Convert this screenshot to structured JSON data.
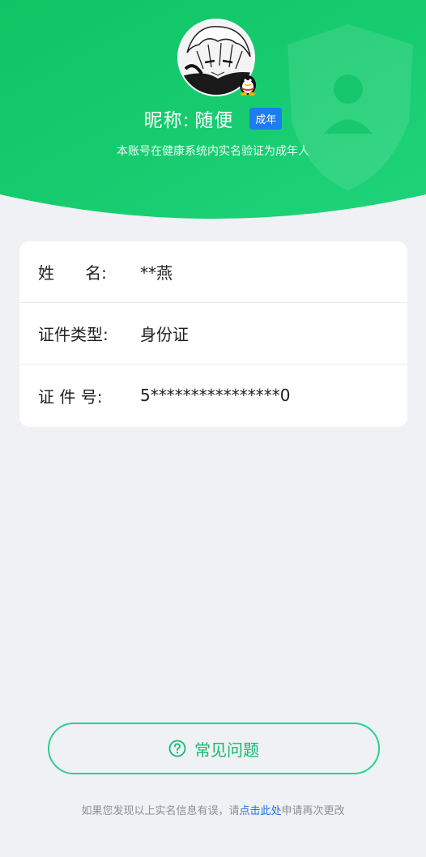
{
  "profile": {
    "nickname_label": "昵称:",
    "nickname": "随便",
    "age_badge": "成年",
    "verify_note": "本账号在健康系统内实名验证为成年人"
  },
  "info_rows": [
    {
      "label": "姓      名:",
      "value": "**燕"
    },
    {
      "label": "证件类型:",
      "value": "身份证"
    },
    {
      "label": "证 件 号:",
      "value": "5****************0"
    }
  ],
  "faq": {
    "label": "常见问题",
    "icon": "question-circle-icon"
  },
  "footer": {
    "prefix": "如果您发现以上实名信息有误，请",
    "link": "点击此处",
    "suffix": "申请再次更改"
  },
  "colors": {
    "header_green": "#12c76a",
    "accent_green": "#17b86f",
    "badge_blue": "#1c7df0",
    "link_blue": "#1c73e8",
    "background": "#eff1f5"
  }
}
